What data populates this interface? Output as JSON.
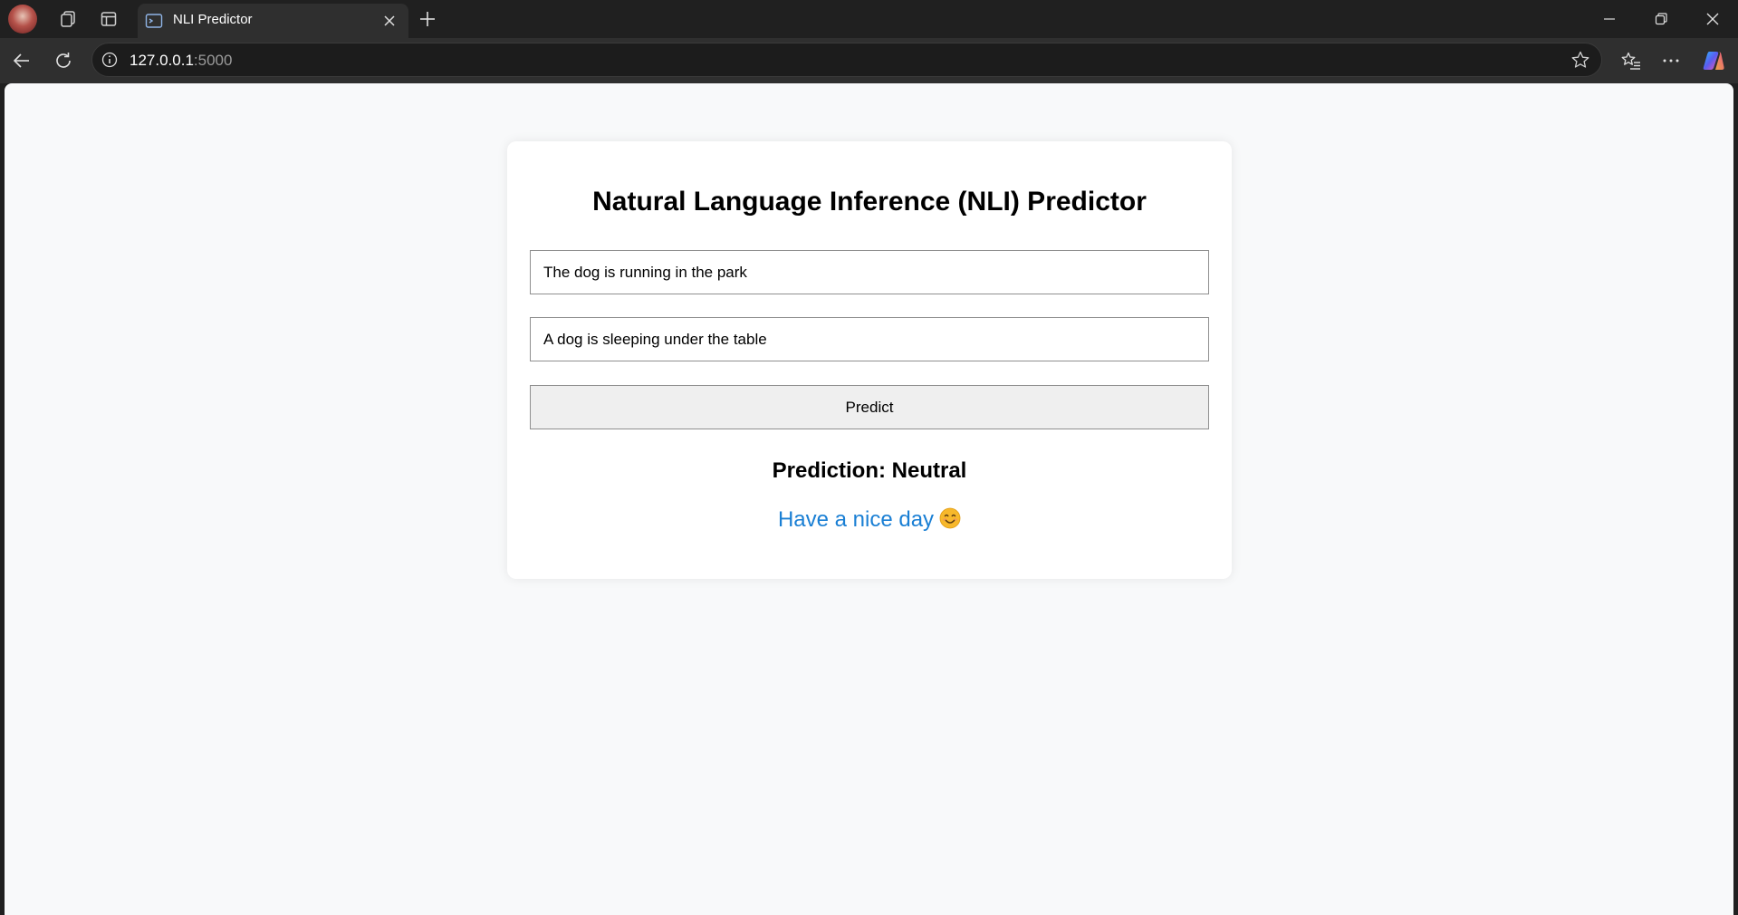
{
  "browser": {
    "tab": {
      "title": "NLI Predictor"
    },
    "address": {
      "host": "127.0.0.1",
      "port": ":5000"
    }
  },
  "page": {
    "title": "Natural Language Inference (NLI) Predictor",
    "premise_value": "The dog is running in the park",
    "hypothesis_value": "A dog is sleeping under the table",
    "predict_label": "Predict",
    "prediction_text": "Prediction: Neutral",
    "greeting_text": "Have a nice day",
    "greeting_emoji": "smiling-face-icon"
  },
  "colors": {
    "greeting": "#1a7fd4",
    "page_background": "#f8f9fa",
    "card_background": "#ffffff"
  }
}
